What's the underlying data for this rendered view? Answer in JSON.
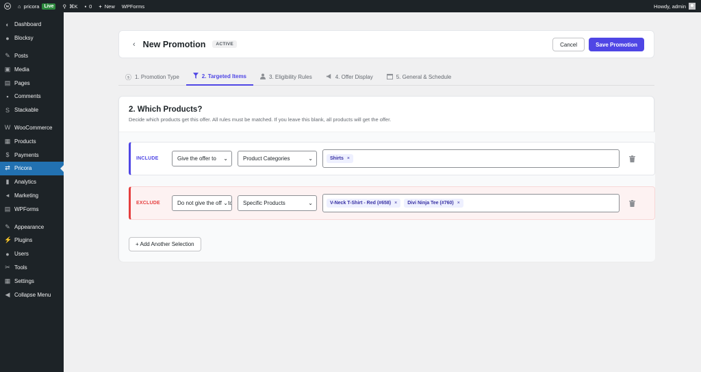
{
  "adminbar": {
    "site_name": "pricora",
    "live_badge": "Live",
    "shortcut": "⌘K",
    "comments_count": "0",
    "new_label": "New",
    "wpforms_label": "WPForms",
    "howdy": "Howdy, admin"
  },
  "sidebar": {
    "items": [
      {
        "label": "Dashboard",
        "icon": "dashboard-icon"
      },
      {
        "label": "Blocksy",
        "icon": "blocksy-icon"
      },
      {
        "label": "Posts",
        "icon": "pin-icon"
      },
      {
        "label": "Media",
        "icon": "media-icon"
      },
      {
        "label": "Pages",
        "icon": "pages-icon"
      },
      {
        "label": "Comments",
        "icon": "comment-icon"
      },
      {
        "label": "Stackable",
        "icon": "stackable-icon"
      },
      {
        "label": "WooCommerce",
        "icon": "woocommerce-icon"
      },
      {
        "label": "Products",
        "icon": "products-icon"
      },
      {
        "label": "Payments",
        "icon": "payments-icon"
      },
      {
        "label": "Pricora",
        "icon": "pricora-icon"
      },
      {
        "label": "Analytics",
        "icon": "analytics-icon"
      },
      {
        "label": "Marketing",
        "icon": "megaphone-icon"
      },
      {
        "label": "WPForms",
        "icon": "wpforms-icon"
      },
      {
        "label": "Appearance",
        "icon": "brush-icon"
      },
      {
        "label": "Plugins",
        "icon": "plugin-icon"
      },
      {
        "label": "Users",
        "icon": "users-icon"
      },
      {
        "label": "Tools",
        "icon": "wrench-icon"
      },
      {
        "label": "Settings",
        "icon": "settings-icon"
      },
      {
        "label": "Collapse Menu",
        "icon": "collapse-icon"
      }
    ]
  },
  "header": {
    "title": "New Promotion",
    "status": "ACTIVE",
    "cancel_label": "Cancel",
    "save_label": "Save Promotion"
  },
  "tabs": [
    {
      "label": "1. Promotion Type",
      "icon": "dollar-icon"
    },
    {
      "label": "2. Targeted Items",
      "icon": "filter-icon"
    },
    {
      "label": "3. Eligibility Rules",
      "icon": "user-icon"
    },
    {
      "label": "4. Offer Display",
      "icon": "megaphone-icon"
    },
    {
      "label": "5. General & Schedule",
      "icon": "calendar-icon"
    }
  ],
  "section": {
    "title": "2. Which Products?",
    "description": "Decide which products get this offer. All rules must be matched. If you leave this blank, all products will get the offer."
  },
  "rules": [
    {
      "type_label": "INCLUDE",
      "mode": "Give the offer to",
      "target": "Product Categories",
      "tags": [
        "Shirts"
      ]
    },
    {
      "type_label": "EXCLUDE",
      "mode": "Do not give the offer to",
      "target": "Specific Products",
      "tags": [
        "V-Neck T-Shirt - Red (#658)",
        "Divi Ninja Tee (#760)"
      ]
    }
  ],
  "add_selection_label": "+ Add Another Selection",
  "colors": {
    "accent": "#4f46e5",
    "include": "#4f46e5",
    "exclude": "#e53e3e",
    "sidebar_bg": "#1d2327",
    "sidebar_active": "#2271b1"
  }
}
